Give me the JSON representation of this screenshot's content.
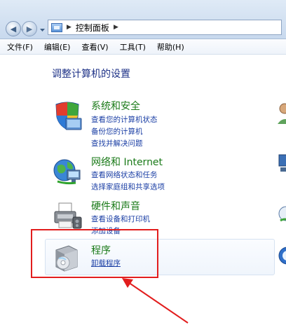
{
  "address_bar": {
    "path": "控制面板"
  },
  "menu": [
    "文件(F)",
    "编辑(E)",
    "查看(V)",
    "工具(T)",
    "帮助(H)"
  ],
  "page_title": "调整计算机的设置",
  "categories": [
    {
      "title": "系统和安全",
      "links": [
        "查看您的计算机状态",
        "备份您的计算机",
        "查找并解决问题"
      ]
    },
    {
      "title": "网络和 Internet",
      "links": [
        "查看网络状态和任务",
        "选择家庭组和共享选项"
      ]
    },
    {
      "title": "硬件和声音",
      "links": [
        "查看设备和打印机",
        "添加设备"
      ]
    },
    {
      "title": "程序",
      "links": [
        "卸载程序"
      ]
    }
  ],
  "colors": {
    "category_title": "#1a7a18",
    "link": "#1b3fa5",
    "page_title": "#1e3287",
    "highlight": "#e21d1d"
  },
  "icons": [
    "shield-icon",
    "network-globe-icon",
    "printer-icon",
    "programs-box-icon",
    "back-arrow-icon",
    "forward-arrow-icon",
    "control-panel-icon"
  ]
}
